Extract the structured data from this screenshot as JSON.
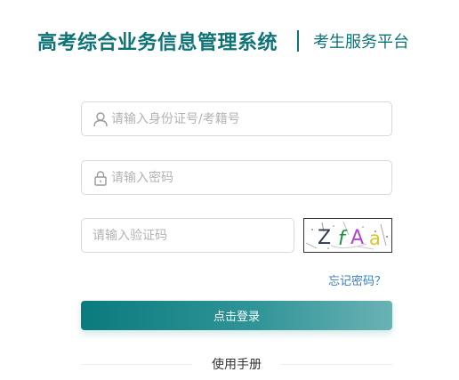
{
  "header": {
    "title": "高考综合业务信息管理系统",
    "subtitle": "考生服务平台"
  },
  "form": {
    "id_placeholder": "请输入身份证号/考籍号",
    "password_placeholder": "请输入密码",
    "captcha_placeholder": "请输入验证码",
    "captcha_text": "ZfAa",
    "forgot_password": "忘记密码？",
    "login_button": "点击登录"
  },
  "footer": {
    "manual_link": "使用手册"
  },
  "icons": {
    "user": "user-icon",
    "lock": "lock-icon"
  },
  "colors": {
    "brand": "#0d7377",
    "link": "#3a7fc1",
    "button_start": "#0b7b7e",
    "button_end": "#6ab2b4"
  }
}
